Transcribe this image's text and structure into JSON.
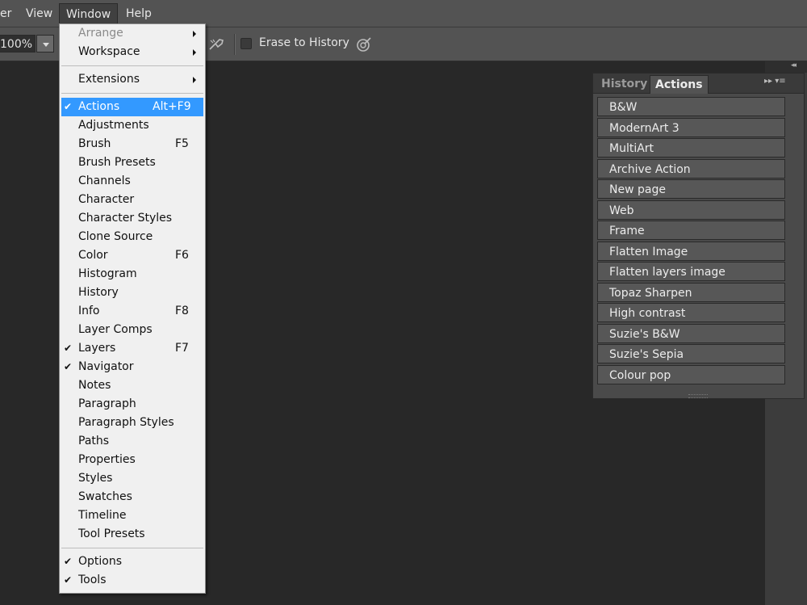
{
  "menubar": {
    "items": [
      "er",
      "View",
      "Window",
      "Help"
    ]
  },
  "options": {
    "zoom": "100%",
    "erase_to_history": "Erase to History",
    "icons": [
      "airbrush-icon",
      "pressure-opacity-icon"
    ]
  },
  "window_menu": {
    "group1": [
      {
        "label": "Arrange",
        "disabled": true,
        "submenu": true
      },
      {
        "label": "Workspace",
        "submenu": true
      }
    ],
    "group2": [
      {
        "label": "Extensions",
        "submenu": true
      }
    ],
    "group3": [
      {
        "label": "Actions",
        "checked": true,
        "shortcut": "Alt+F9",
        "highlighted": true
      },
      {
        "label": "Adjustments"
      },
      {
        "label": "Brush",
        "shortcut": "F5"
      },
      {
        "label": "Brush Presets"
      },
      {
        "label": "Channels"
      },
      {
        "label": "Character"
      },
      {
        "label": "Character Styles"
      },
      {
        "label": "Clone Source"
      },
      {
        "label": "Color",
        "shortcut": "F6"
      },
      {
        "label": "Histogram"
      },
      {
        "label": "History"
      },
      {
        "label": "Info",
        "shortcut": "F8"
      },
      {
        "label": "Layer Comps"
      },
      {
        "label": "Layers",
        "checked": true,
        "shortcut": "F7"
      },
      {
        "label": "Navigator",
        "checked": true
      },
      {
        "label": "Notes"
      },
      {
        "label": "Paragraph"
      },
      {
        "label": "Paragraph Styles"
      },
      {
        "label": "Paths"
      },
      {
        "label": "Properties"
      },
      {
        "label": "Styles"
      },
      {
        "label": "Swatches"
      },
      {
        "label": "Timeline"
      },
      {
        "label": "Tool Presets"
      }
    ],
    "group4": [
      {
        "label": "Options",
        "checked": true
      },
      {
        "label": "Tools",
        "checked": true
      }
    ],
    "check_glyph": "✔"
  },
  "panel": {
    "tabs": [
      "History",
      "Actions"
    ],
    "active_tab": "Actions",
    "actions": [
      "B&W",
      "ModernArt 3",
      "MultiArt",
      "Archive Action",
      "New page",
      "Web",
      "Frame",
      "Flatten Image",
      "Flatten layers image",
      "Topaz Sharpen",
      "High contrast",
      "Suzie's B&W",
      "Suzie's Sepia",
      "Colour pop"
    ],
    "menu_glyph": "▸▸ ▾≡",
    "collapse_glyph": "◂◂"
  },
  "colors": {
    "menu_highlight": "#3399ff",
    "app_bg": "#282828",
    "bar_bg": "#535353"
  }
}
